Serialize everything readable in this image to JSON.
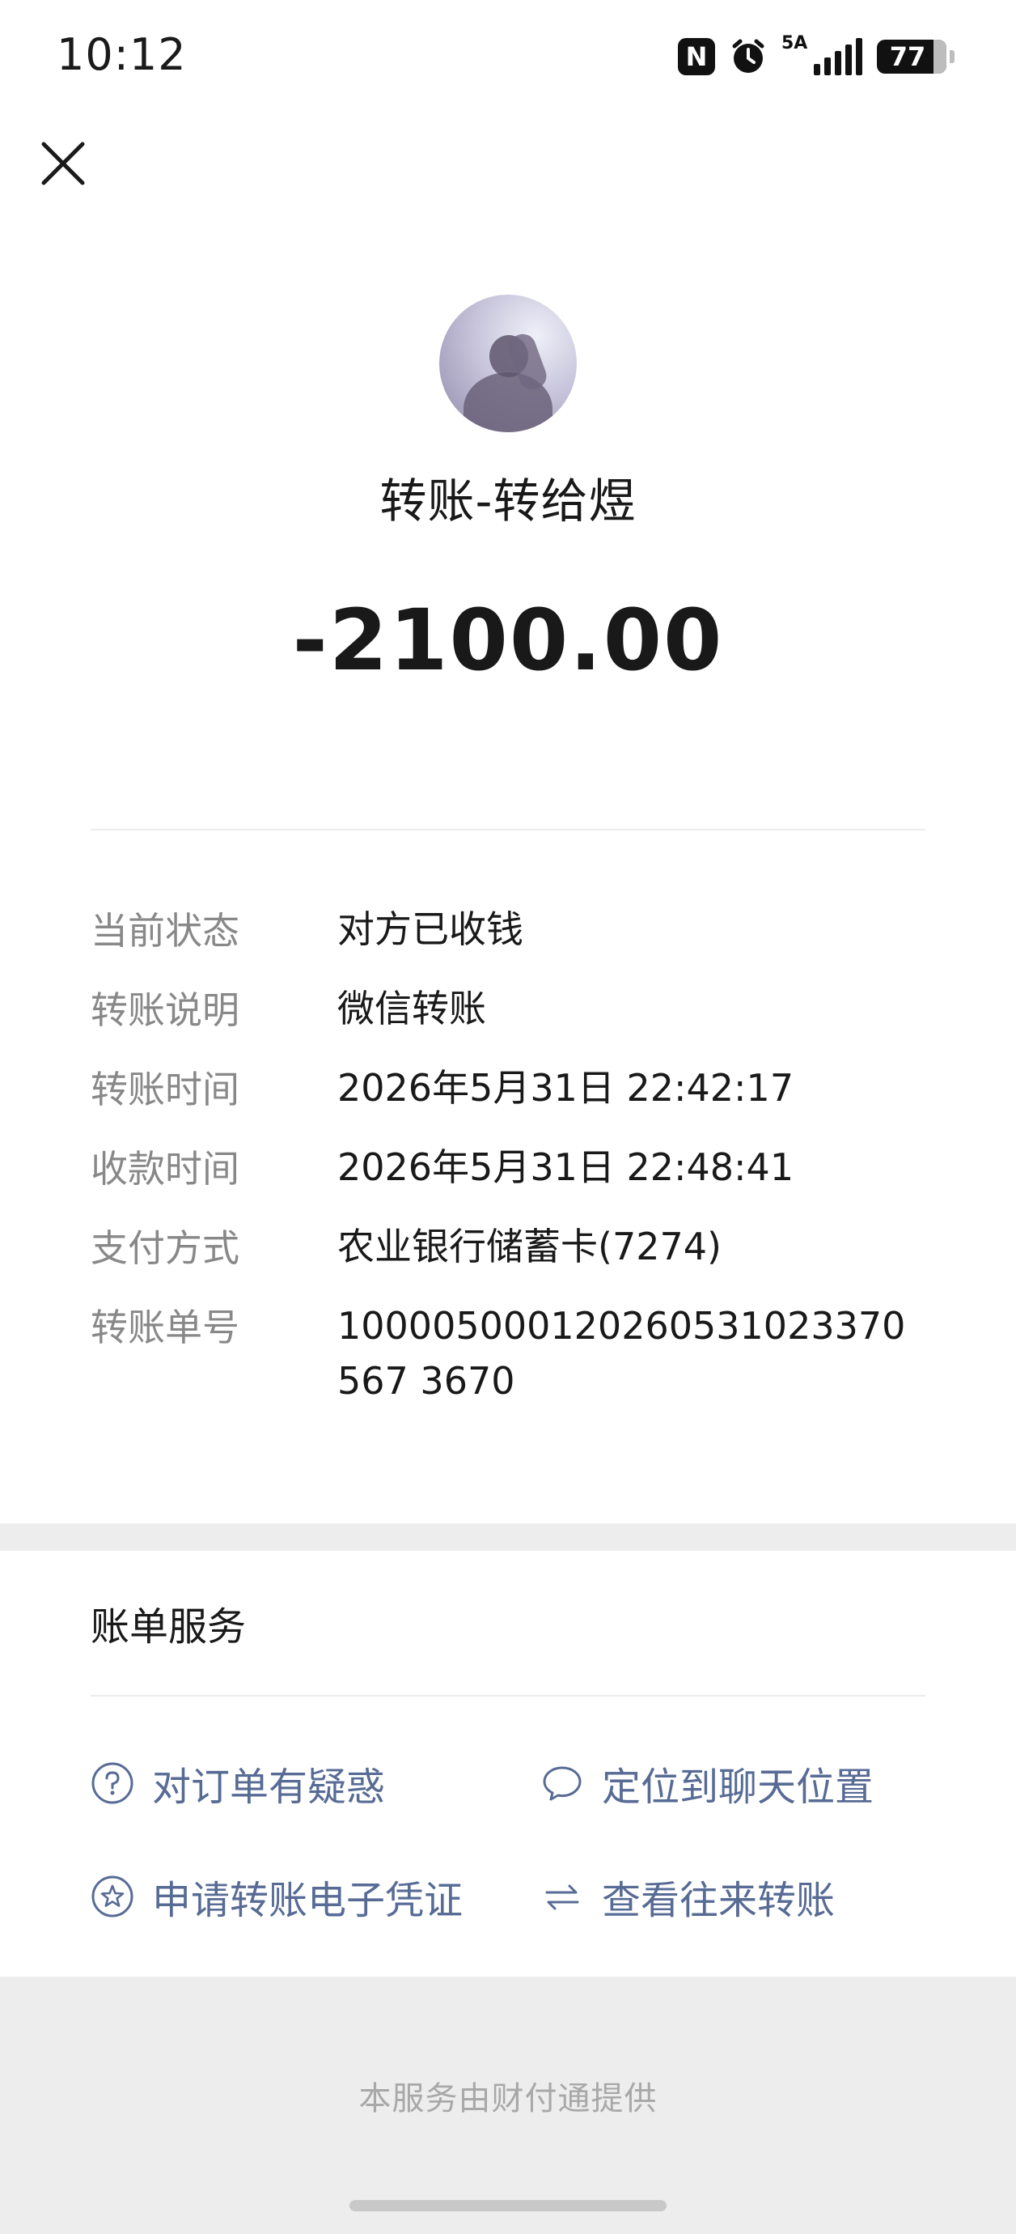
{
  "status_bar": {
    "time": "10:12",
    "nfc_label": "N",
    "network_label": "5A",
    "battery_level": "77"
  },
  "header": {
    "title": "转账-转给煜",
    "amount": "-2100.00"
  },
  "details": [
    {
      "label": "当前状态",
      "value": "对方已收钱"
    },
    {
      "label": "转账说明",
      "value": "微信转账"
    },
    {
      "label": "转账时间",
      "value": "2026年5月31日 22:42:17"
    },
    {
      "label": "收款时间",
      "value": "2026年5月31日 22:48:41"
    },
    {
      "label": "支付方式",
      "value": "农业银行储蓄卡(7274)"
    },
    {
      "label": "转账单号",
      "value": "100005000120260531023370567 3670"
    }
  ],
  "service": {
    "title": "账单服务",
    "items": [
      {
        "label": "对订单有疑惑",
        "icon": "question-circle-icon"
      },
      {
        "label": "定位到聊天位置",
        "icon": "chat-bubble-icon"
      },
      {
        "label": "申请转账电子凭证",
        "icon": "star-circle-icon"
      },
      {
        "label": "查看往来转账",
        "icon": "swap-arrows-icon"
      }
    ]
  },
  "footer": {
    "text": "本服务由财付通提供"
  },
  "colors": {
    "link": "#576b95",
    "label": "#888888",
    "text": "#191919",
    "band": "#ededed"
  }
}
